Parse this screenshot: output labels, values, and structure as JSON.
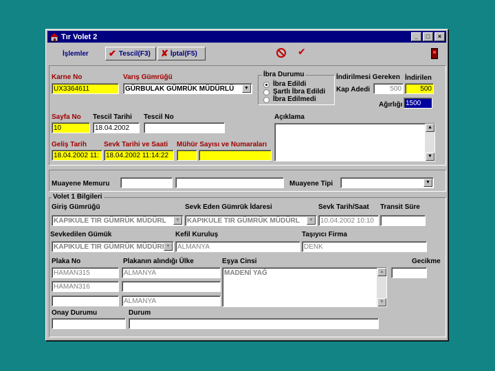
{
  "window": {
    "title": "Tır Volet 2"
  },
  "toolbar": {
    "menu_label": "İşlemler",
    "register_label": "Tescil(F3)",
    "cancel_label": "İptal(F5)"
  },
  "header": {
    "karne_no_label": "Karne No",
    "karne_no_value": "UX3364611",
    "varis_label": "Varış Gümrüğü",
    "varis_value": "GÜRBULAK GÜMRÜK MÜDÜRLÜ",
    "ibra_label": "İbra Durumu",
    "ibra_options": [
      "İbra Edildi",
      "Şartlı İbra Edildi",
      "İbra Edilmedi"
    ],
    "indirilmesi_label": "İndirilmesi Gereken",
    "indirilen_label": "İndirilen",
    "kap_label": "Kap Adedi",
    "kap_value": "500",
    "indirilen_kap_value": "500",
    "agirlik_label": "Ağırlığı",
    "agirlik_value": "1500",
    "sayfa_label": "Sayfa No",
    "sayfa_value": "10",
    "tescil_tarihi_label": "Tescil Tarihi",
    "tescil_tarihi_value": "18.04.2002",
    "tescil_no_label": "Tescil No",
    "tescil_no_value": "",
    "aciklama_label": "Açıklama",
    "gelis_label": "Geliş Tarih",
    "gelis_value": "18.04.2002 11:",
    "sevk_label": "Sevk Tarihi ve Saati",
    "sevk_value": "18.04.2002 11:14:22",
    "muhur_label": "Mühür Sayısı ve Numaraları"
  },
  "muayene": {
    "memur_label": "Muayene Memuru",
    "tipi_label": "Muayene Tipi"
  },
  "volet": {
    "group_label": "Volet 1 Bilgileri",
    "giris_label": "Giriş Gümrüğü",
    "giris_value": "KAPIKULE TIR GÜMRÜK MÜDÜRL",
    "sevk_eden_label": "Sevk Eden Gümrük İdaresi",
    "sevk_eden_value": "KAPIKULE TIR GÜMRÜK MÜDÜRL",
    "sevk_tarih_label": "Sevk Tarih/Saat",
    "sevk_tarih_value": "10.04.2002 10:10",
    "transit_label": "Transit Süre",
    "sevkedilen_label": "Sevkedilen Gümük",
    "sevkedilen_value": "KAPIKULE TIR GÜMRÜK MÜDÜRL",
    "kefil_label": "Kefil Kuruluş",
    "kefil_value": "ALMANYA",
    "tasiyici_label": "Taşıyıcı Firma",
    "tasiyici_value": "DENK",
    "plaka_label": "Plaka No",
    "ulke_label": "Plakanın alındığı Ülke",
    "esya_label": "Eşya Cinsi",
    "esya_value": "MADENİ YAĞ",
    "gecikme_label": "Gecikme",
    "plakalar": [
      "HAMAN315",
      "HAMAN316",
      ""
    ],
    "ulkeler": [
      "ALMANYA",
      "",
      "ALMANYA"
    ],
    "onay_label": "Onay Durumu",
    "durum_label": "Durum"
  }
}
